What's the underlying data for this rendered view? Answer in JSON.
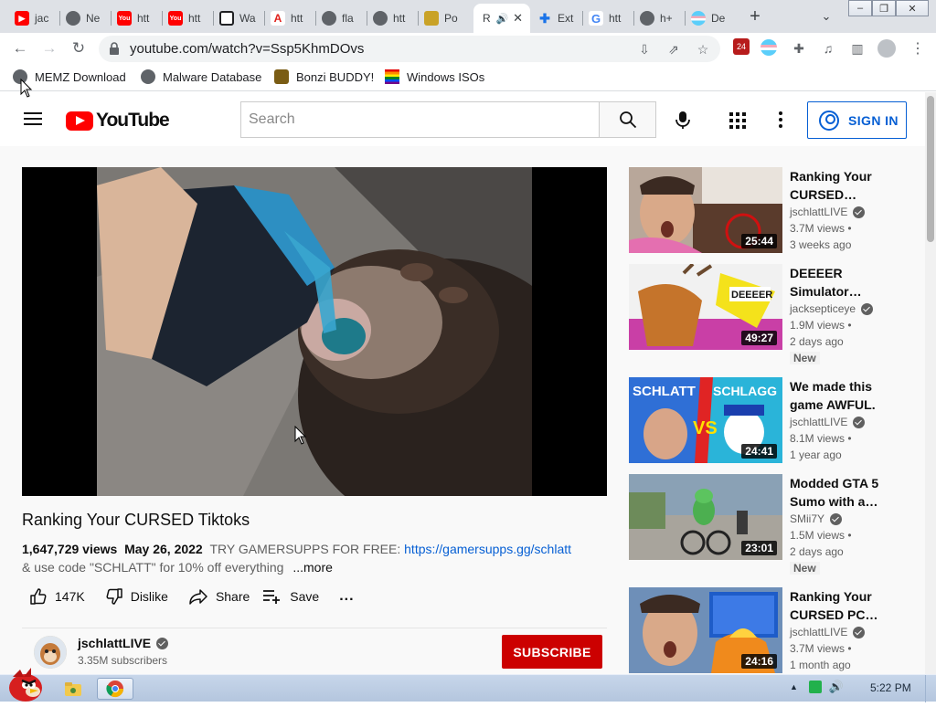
{
  "browser": {
    "tabs": [
      {
        "label": "jac",
        "favicon": "youtube",
        "color": "#ff0000"
      },
      {
        "label": "Ne",
        "favicon": "chrome-gray",
        "color": "#5f6368"
      },
      {
        "label": "htt",
        "favicon": "youtube-text",
        "color": "#ff0000"
      },
      {
        "label": "htt",
        "favicon": "youtube-text",
        "color": "#ff0000"
      },
      {
        "label": "Wa",
        "favicon": "building",
        "color": "#202124"
      },
      {
        "label": "htt",
        "favicon": "adobe",
        "color": "#e0201b"
      },
      {
        "label": "fla",
        "favicon": "globe",
        "color": "#5f6368"
      },
      {
        "label": "htt",
        "favicon": "globe",
        "color": "#5f6368"
      },
      {
        "label": "Po",
        "favicon": "chart",
        "color": "#c9a227"
      },
      {
        "label": "R",
        "favicon": "none",
        "color": "#3c4043",
        "audio": true,
        "active": true
      },
      {
        "label": "Ext",
        "favicon": "puzzle",
        "color": "#1a73e8"
      },
      {
        "label": "htt",
        "favicon": "google",
        "color": "#4285f4"
      },
      {
        "label": "h+",
        "favicon": "globe",
        "color": "#5f6368"
      },
      {
        "label": "De",
        "favicon": "flag",
        "color": "#f5a9b8"
      }
    ],
    "new_tab_symbol": "+",
    "url": "youtube.com/watch?v=Ssp5KhmDOvs",
    "extension_badge": "24",
    "bookmarks": [
      {
        "label": "MEMZ Download",
        "icon": "globe"
      },
      {
        "label": "Malware Database",
        "icon": "globe"
      },
      {
        "label": "Bonzi BUDDY!",
        "icon": "bonzi"
      },
      {
        "label": "Windows ISOs",
        "icon": "rainbow-flag"
      }
    ]
  },
  "youtube": {
    "logo_text": "YouTube",
    "search_placeholder": "Search",
    "sign_in": "SIGN IN",
    "video": {
      "title": "Ranking Your CURSED Tiktoks",
      "views": "1,647,729 views",
      "date": "May 26, 2022",
      "promo": "TRY GAMERSUPPS FOR FREE:",
      "link": "https://gamersupps.gg/schlatt",
      "desc_line2": "& use code \"SCHLATT\" for 10% off everything",
      "more": "...more",
      "likes": "147K",
      "dislike": "Dislike",
      "share": "Share",
      "save": "Save",
      "more_actions": "..."
    },
    "channel": {
      "name": "jschlattLIVE",
      "subscribers": "3.35M subscribers",
      "subscribe": "SUBSCRIBE"
    },
    "recommendations": [
      {
        "title": "Ranking Your CURSED…",
        "channel": "jschlattLIVE",
        "views": "3.7M views",
        "age": "3 weeks ago",
        "duration": "25:44",
        "badge": ""
      },
      {
        "title": "DEEEER Simulator…",
        "channel": "jacksepticeye",
        "views": "1.9M views",
        "age": "2 days ago",
        "duration": "49:27",
        "badge": "New"
      },
      {
        "title": "We made this game AWFUL.",
        "channel": "jschlattLIVE",
        "views": "8.1M views",
        "age": "1 year ago",
        "duration": "24:41",
        "badge": ""
      },
      {
        "title": "Modded GTA 5 Sumo with a…",
        "channel": "SMii7Y",
        "views": "1.5M views",
        "age": "2 days ago",
        "duration": "23:01",
        "badge": "New"
      },
      {
        "title": "Ranking Your CURSED PC…",
        "channel": "jschlattLIVE",
        "views": "3.7M views",
        "age": "1 month ago",
        "duration": "24:16",
        "badge": ""
      }
    ]
  },
  "taskbar": {
    "clock": "5:22 PM"
  }
}
